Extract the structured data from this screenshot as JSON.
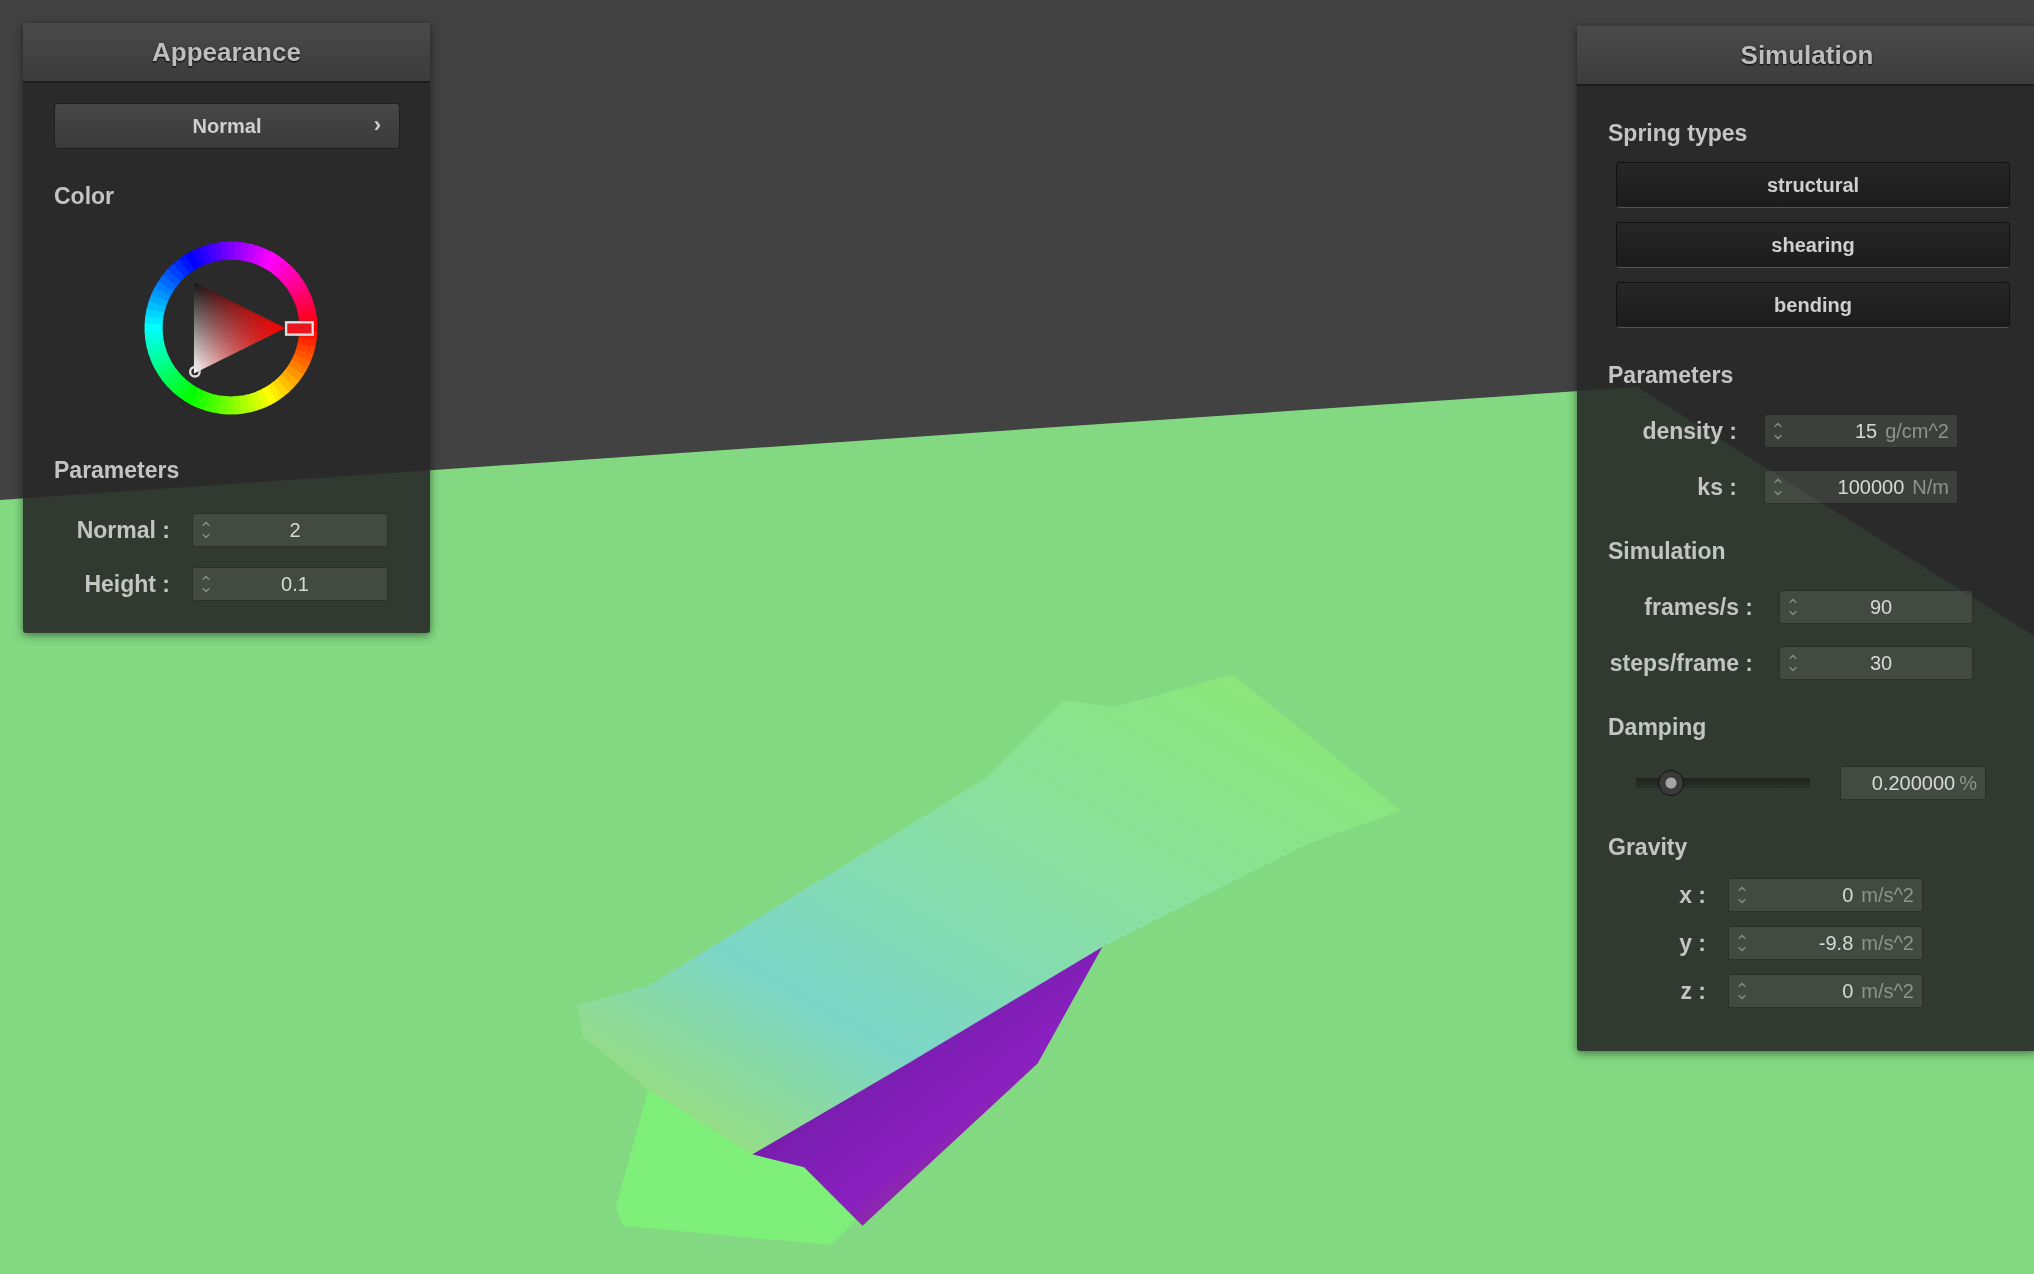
{
  "appearance_panel": {
    "title": "Appearance",
    "mode_button": {
      "label": "Normal",
      "chevron": "›"
    },
    "color_heading": "Color",
    "parameters_heading": "Parameters",
    "fields": [
      {
        "label": "Normal :",
        "value": "2"
      },
      {
        "label": "Height :",
        "value": "0.1"
      }
    ]
  },
  "simulation_panel": {
    "title": "Simulation",
    "spring_types_heading": "Spring types",
    "spring_types": [
      {
        "label": "structural"
      },
      {
        "label": "shearing"
      },
      {
        "label": "bending"
      }
    ],
    "parameters_heading": "Parameters",
    "parameters": [
      {
        "label": "density :",
        "value": "15",
        "unit": "g/cm^2"
      },
      {
        "label": "ks :",
        "value": "100000",
        "unit": "N/m"
      }
    ],
    "simulation_heading": "Simulation",
    "simulation": [
      {
        "label": "frames/s :",
        "value": "90"
      },
      {
        "label": "steps/frame :",
        "value": "30"
      }
    ],
    "damping_heading": "Damping",
    "damping": {
      "level": 0.2,
      "value": "0.200000",
      "unit": "%"
    },
    "gravity_heading": "Gravity",
    "gravity": [
      {
        "label": "x :",
        "value": "0",
        "unit": "m/s^2"
      },
      {
        "label": "y :",
        "value": "-9.8",
        "unit": "m/s^2"
      },
      {
        "label": "z :",
        "value": "0",
        "unit": "m/s^2"
      }
    ]
  }
}
